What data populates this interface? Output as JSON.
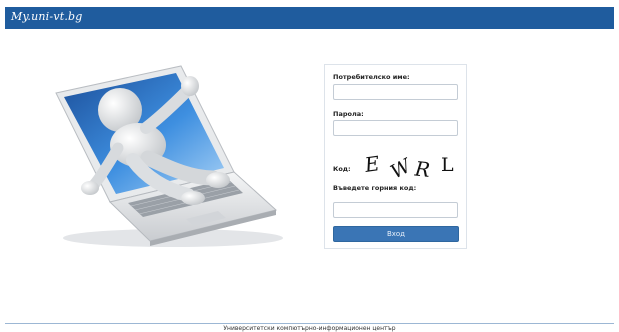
{
  "header": {
    "logo_text": "My.uni-vt.bg",
    "background_color": "#1f5c9e"
  },
  "illustration": {
    "name": "laptop-figure-illustration"
  },
  "login": {
    "username_label": "Потребителско име:",
    "username_value": "",
    "password_label": "Парола:",
    "password_value": "",
    "captcha_label": "Код:",
    "captcha_chars": [
      "E",
      "W",
      "R",
      "L"
    ],
    "captcha_input_label": "Въведете горния код:",
    "captcha_input_value": "",
    "submit_label": "Вход",
    "button_color": "#3a75b5"
  },
  "footer": {
    "text": "Университетски компютърно-информационен център"
  }
}
